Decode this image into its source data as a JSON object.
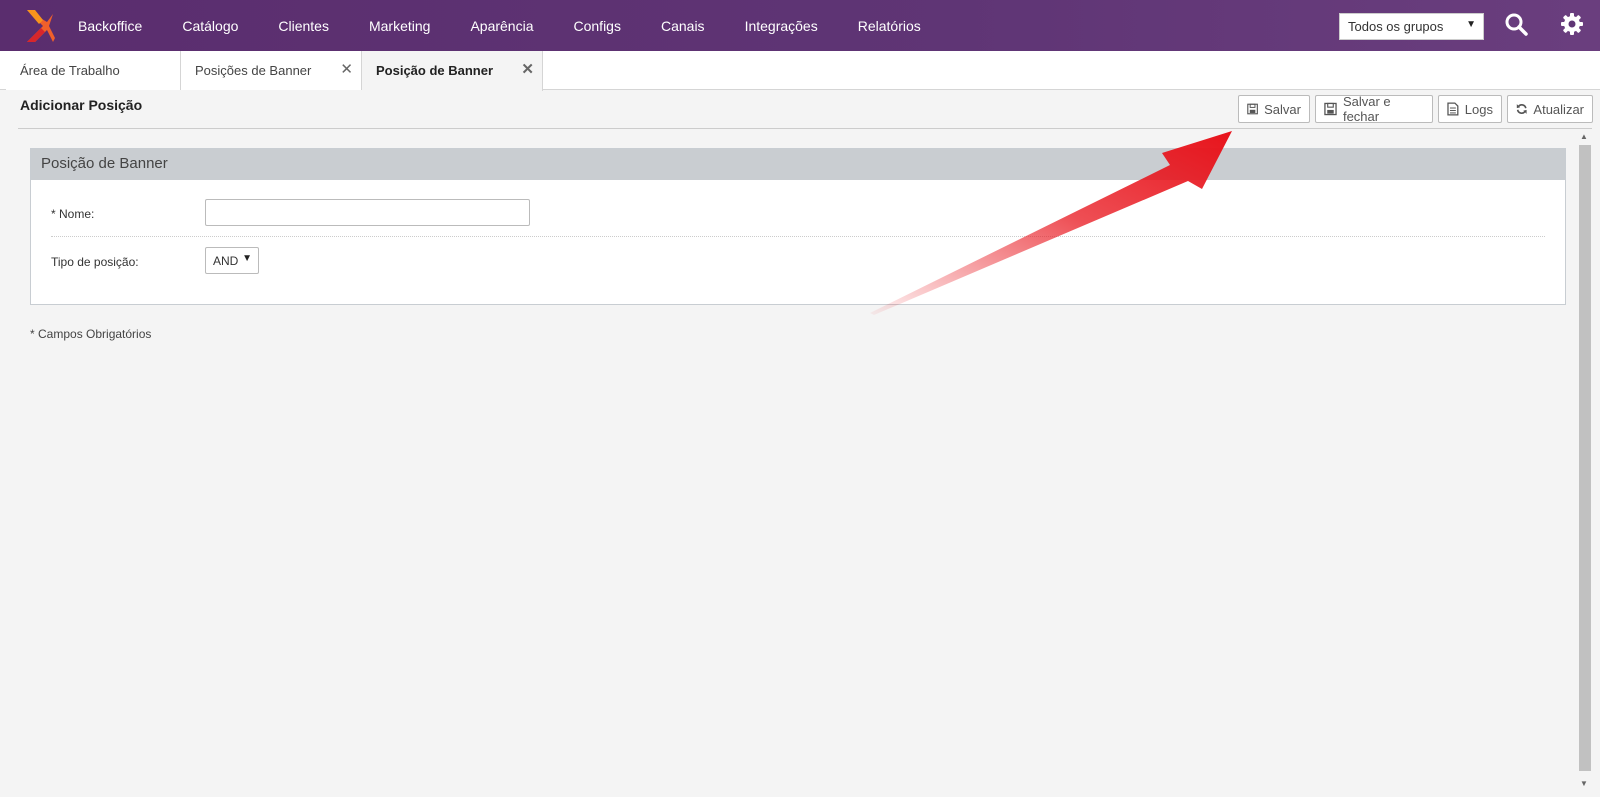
{
  "nav": {
    "items": [
      {
        "label": "Backoffice"
      },
      {
        "label": "Catálogo"
      },
      {
        "label": "Clientes"
      },
      {
        "label": "Marketing"
      },
      {
        "label": "Aparência"
      },
      {
        "label": "Configs"
      },
      {
        "label": "Canais"
      },
      {
        "label": "Integrações"
      },
      {
        "label": "Relatórios"
      }
    ],
    "group_select": "Todos os grupos"
  },
  "tabs": [
    {
      "label": "Área de Trabalho"
    },
    {
      "label": "Posições de Banner"
    },
    {
      "label": "Posição de Banner"
    }
  ],
  "page": {
    "title": "Adicionar Posição",
    "toolbar": {
      "save": "Salvar",
      "save_close": "Salvar e fechar",
      "logs": "Logs",
      "refresh": "Atualizar"
    }
  },
  "panel": {
    "title": "Posição de Banner",
    "name_label": "* Nome:",
    "name_value": "",
    "type_label": "Tipo de posição:",
    "type_value": "AND"
  },
  "required_note": "* Campos Obrigatórios",
  "colors": {
    "nav_bg": "#5f3575",
    "panel_head": "#c9cdd1",
    "annotation_arrow": "#e8131b"
  }
}
